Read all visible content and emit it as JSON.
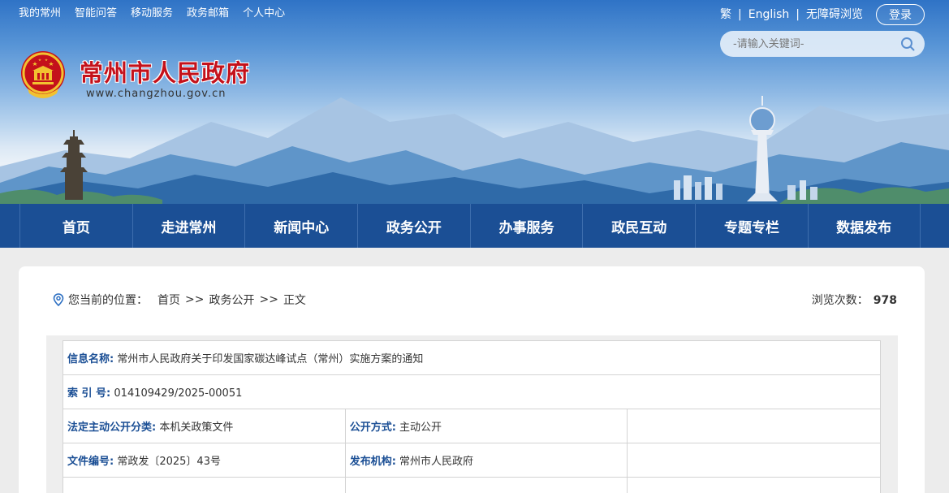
{
  "top_links": [
    "我的常州",
    "智能问答",
    "移动服务",
    "政务邮箱",
    "个人中心"
  ],
  "toolbar": {
    "traditional": "繁",
    "english": "English",
    "accessible": "无障碍浏览",
    "login": "登录"
  },
  "search": {
    "placeholder": "-请输入关键词-"
  },
  "site": {
    "title": "常州市人民政府",
    "url": "www.changzhou.gov.cn"
  },
  "main_nav": [
    "首页",
    "走进常州",
    "新闻中心",
    "政务公开",
    "办事服务",
    "政民互动",
    "专题专栏",
    "数据发布"
  ],
  "breadcrumb": {
    "prefix": "您当前的位置：",
    "items": [
      "首页",
      "政务公开",
      "正文"
    ],
    "separator": ">>"
  },
  "views": {
    "label": "浏览次数：",
    "count": "978"
  },
  "info": {
    "name_label": "信息名称:",
    "name_value": "常州市人民政府关于印发国家碳达峰试点（常州）实施方案的通知",
    "index_label": "索 引 号:",
    "index_value": "014109429/2025-00051",
    "category_label": "法定主动公开分类:",
    "category_value": "本机关政策文件",
    "mode_label": "公开方式:",
    "mode_value": "主动公开",
    "doc_label": "文件编号:",
    "doc_value": "常政发〔2025〕43号",
    "org_label": "发布机构:",
    "org_value": "常州市人民政府"
  },
  "colors": {
    "nav_blue": "#1b4f95",
    "title_red": "#c4111b",
    "label_blue": "#1b4f95"
  }
}
